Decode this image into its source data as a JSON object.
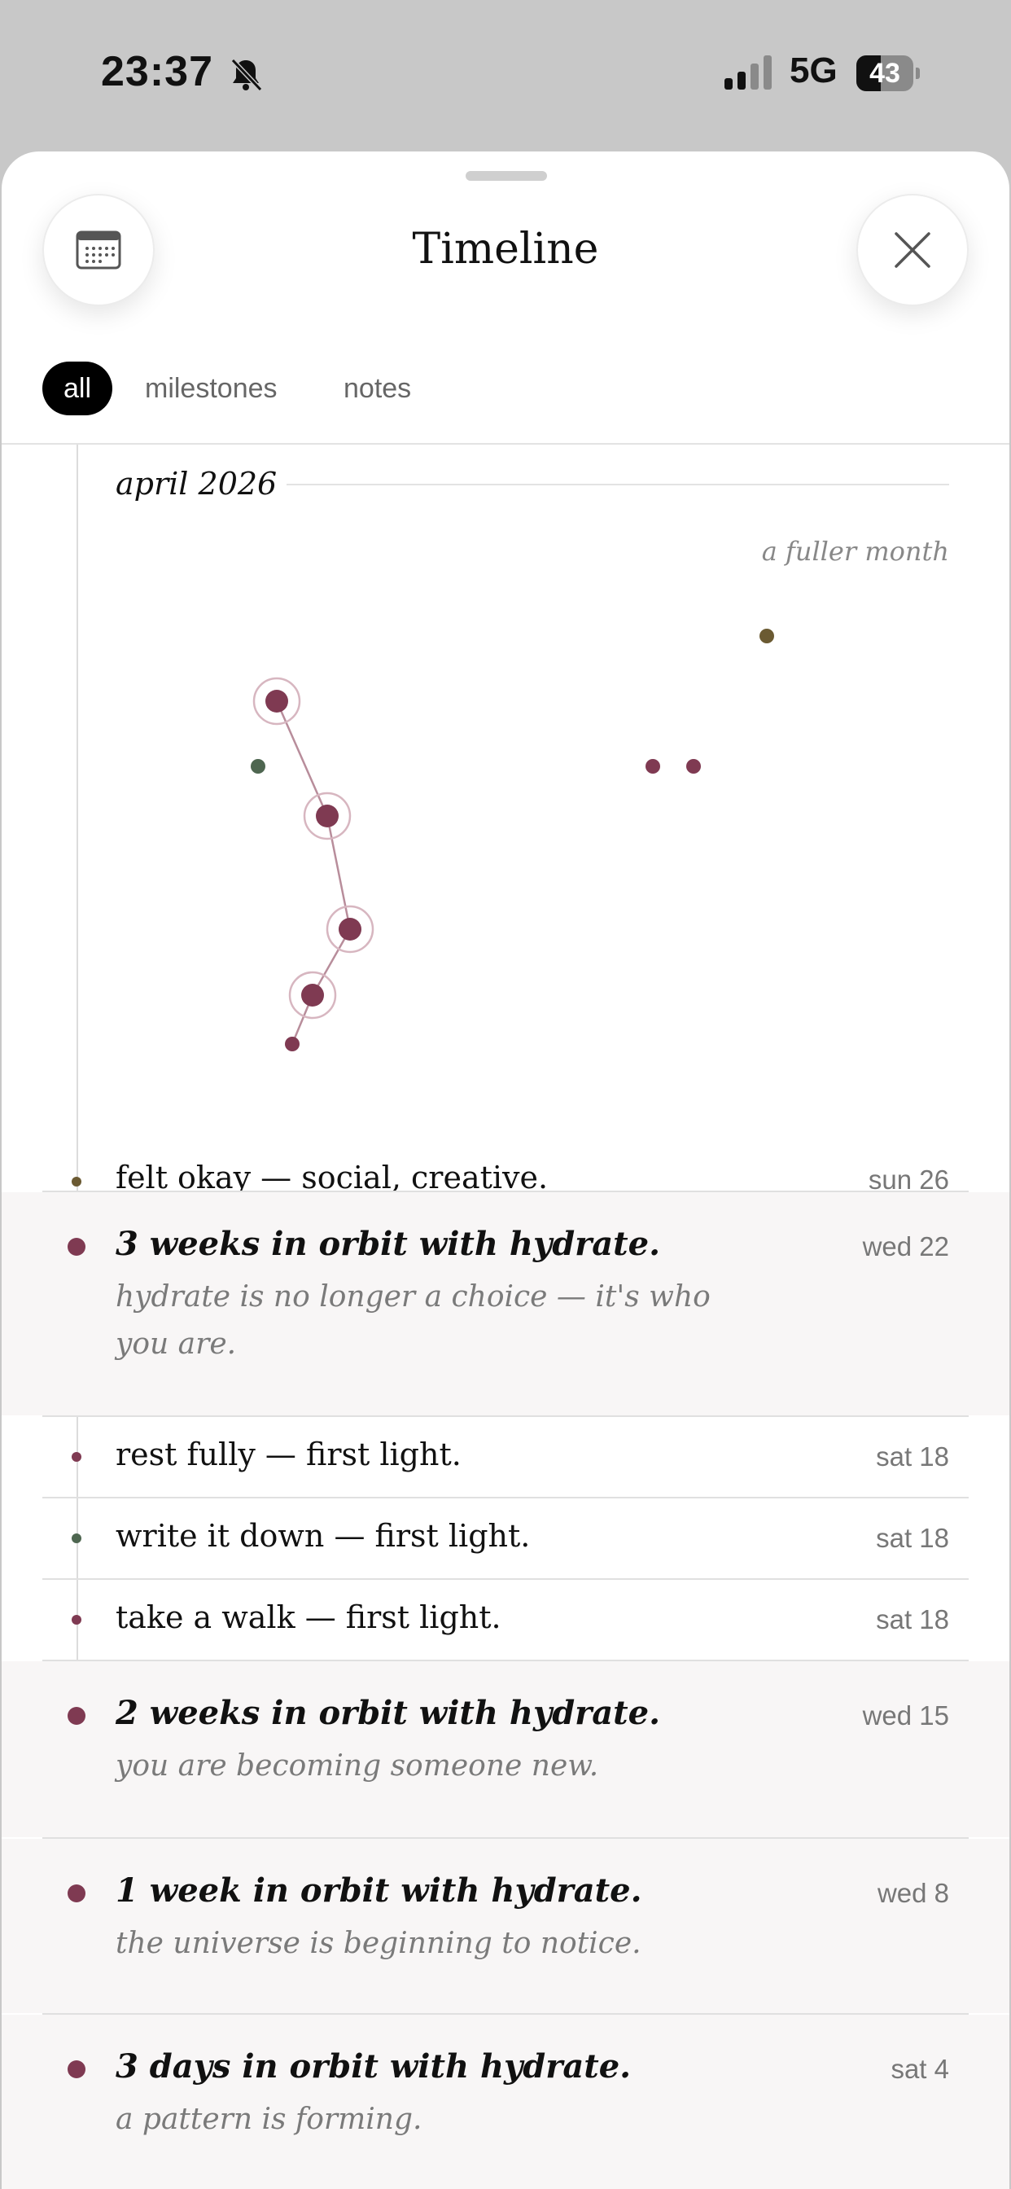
{
  "status_bar": {
    "time": "23:37",
    "network": "5G",
    "battery": "43",
    "battery_level": 0.43
  },
  "header": {
    "title": "Timeline",
    "calendar_icon": "calendar-icon",
    "close_icon": "close-icon"
  },
  "tabs": [
    {
      "label": "all",
      "active": true
    },
    {
      "label": "milestones",
      "active": false
    },
    {
      "label": "notes",
      "active": false
    }
  ],
  "month": {
    "label": "april 2026",
    "note": "a fuller month"
  },
  "colors": {
    "milestone": "#7f3a52",
    "social": "#6b5a32",
    "green": "#4e6650",
    "ring": "#d7b6c0",
    "link": "#b88d9b"
  },
  "entries": [
    {
      "kind": "note",
      "text": "felt okay — social, creative.",
      "date": "sun 26",
      "dot_color": "#6b5a32"
    },
    {
      "kind": "milestone",
      "text": "3 weeks in orbit with hydrate.",
      "sub": "hydrate is no longer a choice — it's who you are.",
      "date": "wed 22",
      "dot_color": "#7f3a52"
    },
    {
      "kind": "note",
      "text": "rest fully — first light.",
      "date": "sat 18",
      "dot_color": "#7f3a52"
    },
    {
      "kind": "note",
      "text": "write it down — first light.",
      "date": "sat 18",
      "dot_color": "#4e6650"
    },
    {
      "kind": "note",
      "text": "take a walk — first light.",
      "date": "sat 18",
      "dot_color": "#7f3a52"
    },
    {
      "kind": "milestone",
      "text": "2 weeks in orbit with hydrate.",
      "sub": "you are becoming someone new.",
      "date": "wed 15",
      "dot_color": "#7f3a52"
    },
    {
      "kind": "milestone",
      "text": "1 week in orbit with hydrate.",
      "sub": "the universe is beginning to notice.",
      "date": "wed 8",
      "dot_color": "#7f3a52"
    },
    {
      "kind": "milestone",
      "text": "3 days in orbit with hydrate.",
      "sub": "a pattern is forming.",
      "date": "sat 4",
      "dot_color": "#7f3a52"
    }
  ]
}
